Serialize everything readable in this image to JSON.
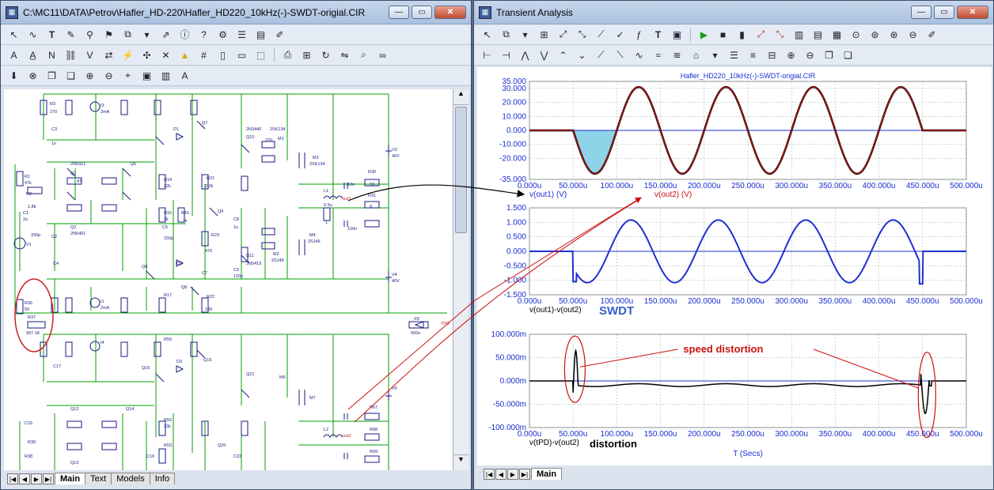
{
  "schematic": {
    "title": "C:\\MC11\\DATA\\Petrov\\Hafler_HD-220\\Hafler_HD220_10kHz(-)-SWDT-origial.CIR",
    "tabs": [
      "Main",
      "Text",
      "Models",
      "Info"
    ],
    "labels": {
      "r3": "R3",
      "v270": "270",
      "c3": "C3",
      "n1": "1n",
      "r1": "R1",
      "k47": "47k",
      "r2": "R2",
      "k18": "1.8k",
      "c1": "C1",
      "u2": "2u",
      "v1": "V1",
      "p330": "330p",
      "c2": "C2",
      "c4": "C4",
      "q1": "Q1",
      "q2": "Q2",
      "n2n5551": "2N5551",
      "n2n5401": "2N5401",
      "r36": "R36",
      "o50": "50",
      "r37": "R37",
      "o997": "997.18",
      "r4": "R4",
      "i1": "I1",
      "ma2": "2mA",
      "i3": "I3",
      "q7": "Q7",
      "q8": "Q8",
      "d1": "D1",
      "d2": "D2",
      "q10": "Q10",
      "q11": "Q11",
      "n2sk134": "2SK134",
      "n2sj49": "2SJ49",
      "m1": "M1",
      "m2": "M2",
      "m3": "M3",
      "m4": "M4",
      "v3": "V3",
      "v4": "V4",
      "v40": "40V",
      "r30": "R30",
      "r31": "R31",
      "l1": "L1",
      "u05": "0.5u",
      "out1": "out1",
      "x9": "X9",
      "n550": "550n",
      "tpd": "TPD",
      "r50": "R50",
      "q16": "Q16",
      "d3": "D3",
      "q15": "Q15",
      "q21": "Q21",
      "m6": "M6",
      "m7": "M7",
      "v9": "V9",
      "l2": "L2",
      "out2": "out2",
      "r67": "R67",
      "r68": "R68",
      "r69": "R69",
      "i4": "I4",
      "c17": "C17",
      "q12": "Q12",
      "q13": "Q13",
      "q14": "Q14",
      "c15": "C15",
      "r38": "R38",
      "r39": "R39",
      "c19": "C19",
      "c22": "C22",
      "r52": "R52",
      "r53": "R53",
      "r14": "R14",
      "r15": "R15",
      "r16": "R16",
      "r17": "R17",
      "r21": "R21",
      "r22": "R22",
      "r23": "R23",
      "c5": "C5",
      "c7": "C7",
      "c8": "C8",
      "c9": "C9",
      "q5": "Q5",
      "q6": "Q6",
      "q9": "Q9",
      "q20": "Q20",
      "n2n3440": "2N3440",
      "n2n5415": "2N5415",
      "o220": "220",
      "o10": "10",
      "o8": "8",
      "n10": "10n",
      "n100": "100n",
      "u1": "1u",
      "n150": "150p",
      "k22": "22k",
      "k33": "33k",
      "k1": "1k",
      "k2": "2k",
      "k2_2": "2.2k",
      "o470": "470",
      "o100": "100",
      "o47": "47",
      "o1": "1",
      "n120": "120p"
    }
  },
  "transient": {
    "title": "Transient Analysis",
    "tab": "Main",
    "chart_data": [
      {
        "type": "line",
        "title": "Hafler_HD220_10kHz(-)-SWDT-origial.CIR",
        "x_ticks": [
          "0.000u",
          "50.000u",
          "100.000u",
          "150.000u",
          "200.000u",
          "250.000u",
          "300.000u",
          "350.000u",
          "400.000u",
          "450.000u",
          "500.000u"
        ],
        "y_ticks": [
          "35.000",
          "30.000",
          "20.000",
          "10.000",
          "0.000",
          "-10.000",
          "-20.000",
          "-35.000"
        ],
        "ylim": [
          -35,
          35
        ],
        "series": [
          {
            "name": "v(out1) (V)",
            "color": "#1f2fd0"
          },
          {
            "name": "v(out2) (V)",
            "color": "#cc1111"
          }
        ],
        "burst": {
          "start_us": 50,
          "end_us": 450,
          "freq_khz": 10,
          "amplitude": 31
        }
      },
      {
        "type": "line",
        "y_ticks": [
          "1.500",
          "1.000",
          "0.500",
          "0.000",
          "-0.500",
          "-1.000",
          "-1.500"
        ],
        "ylim": [
          -1.5,
          1.5
        ],
        "series": [
          {
            "name": "v(out1)-v(out2)",
            "color": "#1f2fd0"
          }
        ],
        "amplitude": 1.08,
        "annotation": "SWDT"
      },
      {
        "type": "line",
        "y_ticks": [
          "100.000m",
          "50.000m",
          "0.000m",
          "-50.000m",
          "-100.000m"
        ],
        "ylim": [
          -100,
          100
        ],
        "series": [
          {
            "name": "v(tPD)-v(out2)",
            "color": "#000000"
          }
        ],
        "xlabel": "T (Secs)",
        "annotations": [
          "speed distortion",
          "distortion"
        ]
      }
    ]
  }
}
